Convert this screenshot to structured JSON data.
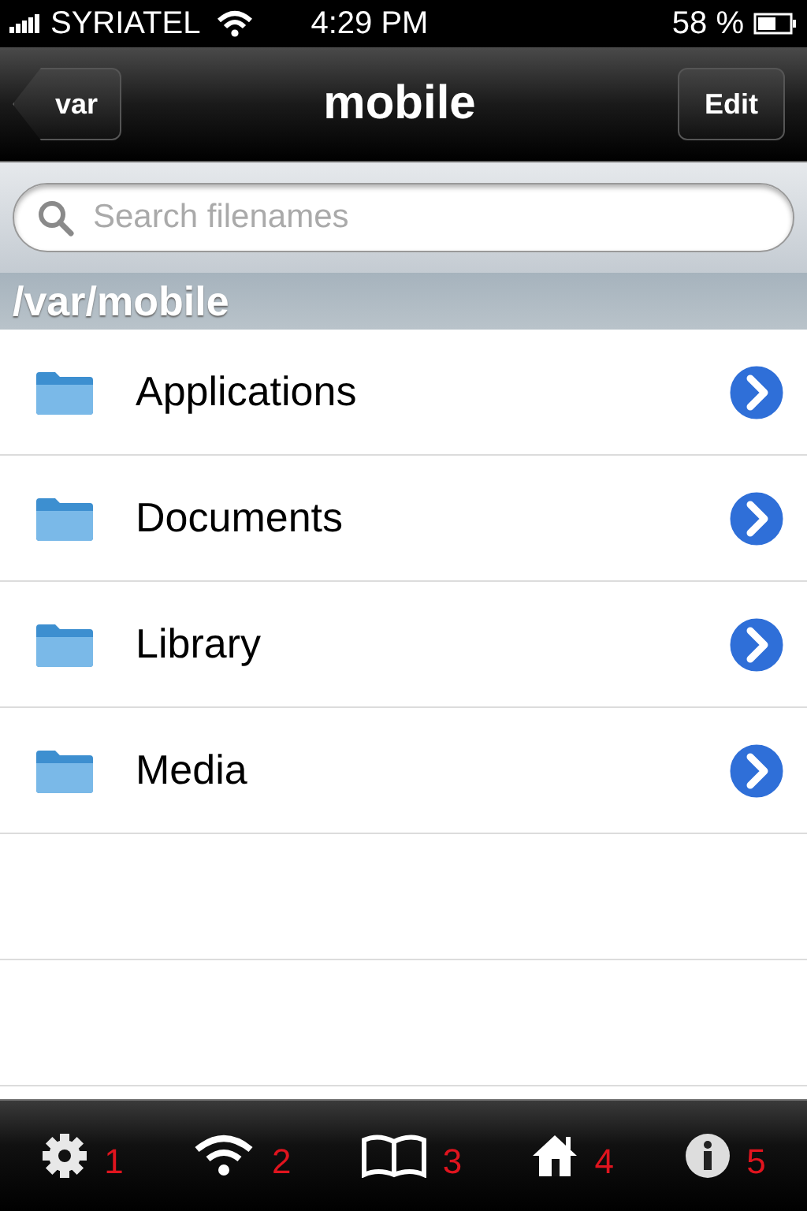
{
  "status_bar": {
    "carrier": "SYRIATEL",
    "time": "4:29 PM",
    "battery": "58 %"
  },
  "nav_bar": {
    "back": "var",
    "title": "mobile",
    "action": "Edit"
  },
  "search": {
    "placeholder": "Search filenames"
  },
  "section_header": "/var/mobile",
  "files": [
    {
      "name": "Applications"
    },
    {
      "name": "Documents"
    },
    {
      "name": "Library"
    },
    {
      "name": "Media"
    }
  ],
  "toolbar": [
    {
      "kind": "gear",
      "number": "1"
    },
    {
      "kind": "wifi",
      "number": "2"
    },
    {
      "kind": "book",
      "number": "3"
    },
    {
      "kind": "home",
      "number": "4"
    },
    {
      "kind": "info",
      "number": "5"
    }
  ]
}
